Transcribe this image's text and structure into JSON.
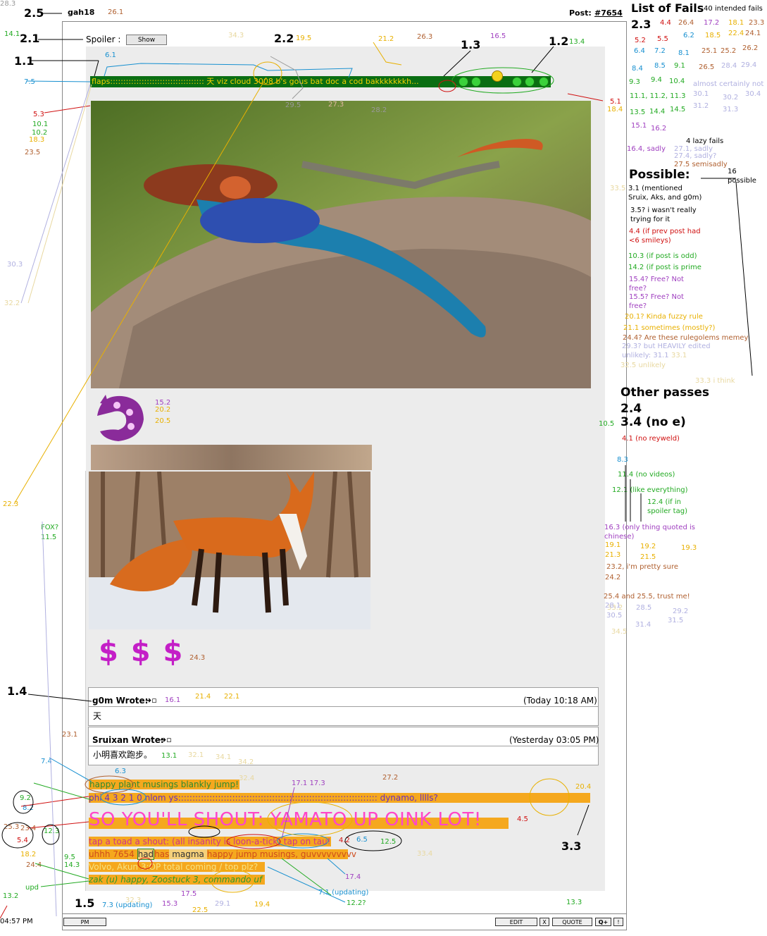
{
  "post": {
    "user": "gah18",
    "post_label": "Post:",
    "post_number": "#7654",
    "spoiler_label": "Spoiler :",
    "spoiler_button": "Show",
    "time": "04:57 PM",
    "pm": "PM",
    "edit": "EDIT",
    "x": "X",
    "quote": "QUOTE",
    "qplus": "Q+",
    "bang": "!"
  },
  "flaps_text": "flaps:::::::::::::::::::::::::::::::::::: 天 viz cloud 3008 b's gous bat doc a cod bakkkkkkkh...",
  "quotes": [
    {
      "author": "g0m Wrote:",
      "time": "(Today 10:18 AM)",
      "body": "天"
    },
    {
      "author": "Sruixan Wrote:",
      "time": "(Yesterday 03:05 PM)",
      "body": "小明喜欢跑步。"
    }
  ],
  "sig_lines": {
    "l1": "happy plant musings blankly jump!",
    "l2": "phi 4 3 2 1 0 nlom ys:::::::::::::::::::::::::::::::::::::::::::::::::::::::::::::::::::::: dynamo, lllls?",
    "l3": "SO YOU'LL SHOUT: YAMATO UP OINK LOT!",
    "l4": "tap a toad a shout: (all insanity is loon-a-tick) tap on tau!",
    "l5a": "uhhh 7654 ",
    "l5b": "had",
    "l5c": "has",
    "l5d": " magma ",
    "l5e": "happy jump musings, guvvvvvvvvv",
    "l6": "Volvo, Akun 3:OP total coming / top plz?",
    "l7": "zak (u) happy, Zoostuck 3, commando uf"
  },
  "dollar": "$ $ $",
  "labels_big": {
    "a25": "2.5",
    "a21": "2.1",
    "a11": "1.1",
    "a22": "2.2",
    "a13": "1.3",
    "a12": "1.2",
    "a14": "1.4",
    "a15": "1.5",
    "a33": "3.3"
  },
  "right": {
    "title": "List of Fails",
    "intended": "40 intended fails",
    "n23": "2.3",
    "possible_title": "Possible:",
    "lazy": "4 lazy fails",
    "sixteen": "16",
    "possible_word": "possible",
    "other": "Other passes",
    "o24": "2.4",
    "o34": "3.4 (no e)"
  },
  "annotations": [
    {
      "t": "26.1",
      "c": "#b06030"
    },
    {
      "t": "14.1",
      "c": "#22aa22"
    },
    {
      "t": "34.3",
      "c": "#e8d8a0"
    },
    {
      "t": "19.5",
      "c": "#e8b000"
    },
    {
      "t": "21.2",
      "c": "#e8b000"
    },
    {
      "t": "26.3",
      "c": "#b06030"
    },
    {
      "t": "16.5",
      "c": "#a040c0"
    },
    {
      "t": "13.4",
      "c": "#22aa22"
    },
    {
      "t": "6.1",
      "c": "#1890d0"
    },
    {
      "t": "7.5",
      "c": "#1890d0"
    },
    {
      "t": "5.3",
      "c": "#d01010"
    },
    {
      "t": "10.1",
      "c": "#22aa22"
    },
    {
      "t": "10.2",
      "c": "#22aa22"
    },
    {
      "t": "18.3",
      "c": "#e8b000"
    },
    {
      "t": "23.5",
      "c": "#b06030"
    },
    {
      "t": "29.5",
      "c": "#999"
    },
    {
      "t": "27.3",
      "c": "#e0b8a0"
    },
    {
      "t": "28.2",
      "c": "#999"
    },
    {
      "t": "5.1",
      "c": "#d01010"
    },
    {
      "t": "18.4",
      "c": "#e8b000"
    },
    {
      "t": "33.5",
      "c": "#e8d8a0"
    },
    {
      "t": "30.3",
      "c": "#b0b0e0"
    },
    {
      "t": "32.2",
      "c": "#e8d8a0"
    },
    {
      "t": "15.2",
      "c": "#a040c0"
    },
    {
      "t": "20.2",
      "c": "#e8b000"
    },
    {
      "t": "20.5",
      "c": "#e8b000"
    },
    {
      "t": "10.5",
      "c": "#22aa22"
    },
    {
      "t": "22.3",
      "c": "#e8b000"
    },
    {
      "t": "FOX?",
      "c": "#22aa22"
    },
    {
      "t": "11.5",
      "c": "#22aa22"
    },
    {
      "t": "24.3",
      "c": "#b06030"
    },
    {
      "t": "16.1",
      "c": "#a040c0"
    },
    {
      "t": "21.4",
      "c": "#e8b000"
    },
    {
      "t": "22.1",
      "c": "#e8b000"
    },
    {
      "t": "13.1",
      "c": "#22aa22"
    },
    {
      "t": "32.1",
      "c": "#e8d8a0"
    },
    {
      "t": "34.1",
      "c": "#e8d8a0"
    },
    {
      "t": "34.2",
      "c": "#e8d8a0"
    },
    {
      "t": "23.1",
      "c": "#b06030"
    },
    {
      "t": "7.4",
      "c": "#1890d0"
    },
    {
      "t": "6.3",
      "c": "#1890d0"
    },
    {
      "t": "32.4",
      "c": "#e8d8a0"
    },
    {
      "t": "17.1 17.3",
      "c": "#a040c0"
    },
    {
      "t": "27.2",
      "c": "#b06030"
    },
    {
      "t": "20.4",
      "c": "#e8b000"
    },
    {
      "t": "9.2",
      "c": "#22aa22"
    },
    {
      "t": "8.2",
      "c": "#1890d0"
    },
    {
      "t": "4.5",
      "c": "#d01010"
    },
    {
      "t": "23.4",
      "c": "#b06030"
    },
    {
      "t": "5.4",
      "c": "#d01010"
    },
    {
      "t": "12.3",
      "c": "#22aa22"
    },
    {
      "t": "25.3",
      "c": "#b06030"
    },
    {
      "t": "18.2",
      "c": "#e8b000"
    },
    {
      "t": "24.4",
      "c": "#b06030"
    },
    {
      "t": "9.5",
      "c": "#22aa22"
    },
    {
      "t": "14.3",
      "c": "#22aa22"
    },
    {
      "t": "upd",
      "c": "#22aa22"
    },
    {
      "t": "13.2",
      "c": "#22aa22"
    },
    {
      "t": "4.2",
      "c": "#d01010"
    },
    {
      "t": "6.5",
      "c": "#1890d0"
    },
    {
      "t": "12.5",
      "c": "#22aa22"
    },
    {
      "t": "33.4",
      "c": "#e8d8a0"
    },
    {
      "t": "17.4",
      "c": "#a040c0"
    },
    {
      "t": "7.1 (updating)",
      "c": "#1890d0"
    },
    {
      "t": "12.2?",
      "c": "#22aa22"
    },
    {
      "t": "7.3 (updating)",
      "c": "#1890d0"
    },
    {
      "t": "32.3",
      "c": "#e8d8a0"
    },
    {
      "t": "15.3",
      "c": "#a040c0"
    },
    {
      "t": "17.5",
      "c": "#a040c0"
    },
    {
      "t": "22.5",
      "c": "#e8b000"
    },
    {
      "t": "29.1",
      "c": "#b0b0e0"
    },
    {
      "t": "19.4",
      "c": "#e8b000"
    },
    {
      "t": "13.3",
      "c": "#22aa22"
    },
    {
      "t": "33.2",
      "c": "#e8d8a0"
    },
    {
      "t": "28.3",
      "c": "#999"
    }
  ],
  "fails": [
    {
      "t": "4.4",
      "c": "#d01010"
    },
    {
      "t": "26.4",
      "c": "#b06030"
    },
    {
      "t": "17.2",
      "c": "#a040c0"
    },
    {
      "t": "18.1",
      "c": "#e8b000"
    },
    {
      "t": "23.3",
      "c": "#b06030"
    },
    {
      "t": "5.2",
      "c": "#d01010"
    },
    {
      "t": "5.5",
      "c": "#d01010"
    },
    {
      "t": "6.2",
      "c": "#1890d0"
    },
    {
      "t": "18.5",
      "c": "#e8b000"
    },
    {
      "t": "22.4",
      "c": "#e8b000"
    },
    {
      "t": "24.1",
      "c": "#b06030"
    },
    {
      "t": "6.4",
      "c": "#1890d0"
    },
    {
      "t": "7.2",
      "c": "#1890d0"
    },
    {
      "t": "8.1",
      "c": "#1890d0"
    },
    {
      "t": "25.1",
      "c": "#b06030"
    },
    {
      "t": "25.2",
      "c": "#b06030"
    },
    {
      "t": "26.2",
      "c": "#b06030"
    },
    {
      "t": "8.4",
      "c": "#1890d0"
    },
    {
      "t": "8.5",
      "c": "#1890d0"
    },
    {
      "t": "9.1",
      "c": "#22aa22"
    },
    {
      "t": "26.5",
      "c": "#b06030"
    },
    {
      "t": "28.4",
      "c": "#b0b0e0"
    },
    {
      "t": "29.4",
      "c": "#b0b0e0"
    },
    {
      "t": "9.3",
      "c": "#22aa22"
    },
    {
      "t": "9.4",
      "c": "#22aa22"
    },
    {
      "t": "10.4",
      "c": "#22aa22"
    },
    {
      "t": "almost certainly not",
      "c": "#b0b0e0"
    },
    {
      "t": "30.1",
      "c": "#b0b0e0"
    },
    {
      "t": "30.4",
      "c": "#b0b0e0"
    },
    {
      "t": "11.1, 11.2, 11.3",
      "c": "#22aa22"
    },
    {
      "t": "30.2",
      "c": "#b0b0e0"
    },
    {
      "t": "31.2",
      "c": "#b0b0e0"
    },
    {
      "t": "31.3",
      "c": "#b0b0e0"
    },
    {
      "t": "13.5",
      "c": "#22aa22"
    },
    {
      "t": "14.4",
      "c": "#22aa22"
    },
    {
      "t": "14.5",
      "c": "#22aa22"
    },
    {
      "t": "15.1",
      "c": "#a040c0"
    },
    {
      "t": "16.2",
      "c": "#a040c0"
    },
    {
      "t": "16.4, sadly",
      "c": "#a040c0"
    },
    {
      "t": "27.1, sadly",
      "c": "#b0b0e0"
    },
    {
      "t": "27.4, sadly?",
      "c": "#b0b0e0"
    },
    {
      "t": "27.5 semisadly",
      "c": "#b06030"
    }
  ],
  "possible": [
    {
      "t": "3.1 (mentioned",
      "c": "#000"
    },
    {
      "t": "Sruix, Aks, and g0m)",
      "c": "#000"
    },
    {
      "t": "3.5? i wasn't really",
      "c": "#000"
    },
    {
      "t": "trying for it",
      "c": "#000"
    },
    {
      "t": "4.4 (if prev post had",
      "c": "#d01010"
    },
    {
      "t": "<6 smileys)",
      "c": "#d01010"
    },
    {
      "t": "10.3 (if post is odd)",
      "c": "#22aa22"
    },
    {
      "t": "14.2 (if post is prime",
      "c": "#22aa22"
    },
    {
      "t": "15.4? Free? Not",
      "c": "#a040c0"
    },
    {
      "t": "free?",
      "c": "#a040c0"
    },
    {
      "t": "15.5? Free? Not",
      "c": "#a040c0"
    },
    {
      "t": "free?",
      "c": "#a040c0"
    },
    {
      "t": "20.1? Kinda fuzzy rule",
      "c": "#e8b000"
    },
    {
      "t": "21.1 sometimes (mostly?)",
      "c": "#e8b000"
    },
    {
      "t": "24.4? Are these rulegolems memey",
      "c": "#b06030"
    },
    {
      "t": "29.3? but HEAVILY edited",
      "c": "#b0b0e0"
    },
    {
      "t": "unlikely: 31.1",
      "c": "#b0b0e0"
    },
    {
      "t": "33.1",
      "c": "#e8d8a0"
    },
    {
      "t": "32.5 unlikely",
      "c": "#e8d8a0"
    },
    {
      "t": "33.3 i think",
      "c": "#e8d8a0"
    }
  ],
  "others": [
    {
      "t": "4.1 (no reyweld)",
      "c": "#d01010"
    },
    {
      "t": "8.3",
      "c": "#1890d0"
    },
    {
      "t": "11.4 (no videos)",
      "c": "#22aa22"
    },
    {
      "t": "12.1 (like everything)",
      "c": "#22aa22"
    },
    {
      "t": "12.4 (if in",
      "c": "#22aa22"
    },
    {
      "t": "spoiler tag)",
      "c": "#22aa22"
    },
    {
      "t": "16.3 (only thing quoted is",
      "c": "#a040c0"
    },
    {
      "t": "chinese)",
      "c": "#a040c0"
    },
    {
      "t": "19.1",
      "c": "#e8b000"
    },
    {
      "t": "19.2",
      "c": "#e8b000"
    },
    {
      "t": "19.3",
      "c": "#e8b000"
    },
    {
      "t": "21.3",
      "c": "#e8b000"
    },
    {
      "t": "21.5",
      "c": "#e8b000"
    },
    {
      "t": "23.2,  i'm pretty sure",
      "c": "#b06030"
    },
    {
      "t": "24.2",
      "c": "#b06030"
    },
    {
      "t": "25.4 and 25.5, trust me!",
      "c": "#b06030"
    },
    {
      "t": "28.1",
      "c": "#b0b0e0"
    },
    {
      "t": "28.5",
      "c": "#b0b0e0"
    },
    {
      "t": "29.2",
      "c": "#b0b0e0"
    },
    {
      "t": "30.5",
      "c": "#b0b0e0"
    },
    {
      "t": "31.4",
      "c": "#b0b0e0"
    },
    {
      "t": "31.5",
      "c": "#b0b0e0"
    },
    {
      "t": "34.5",
      "c": "#e8d8a0"
    }
  ]
}
